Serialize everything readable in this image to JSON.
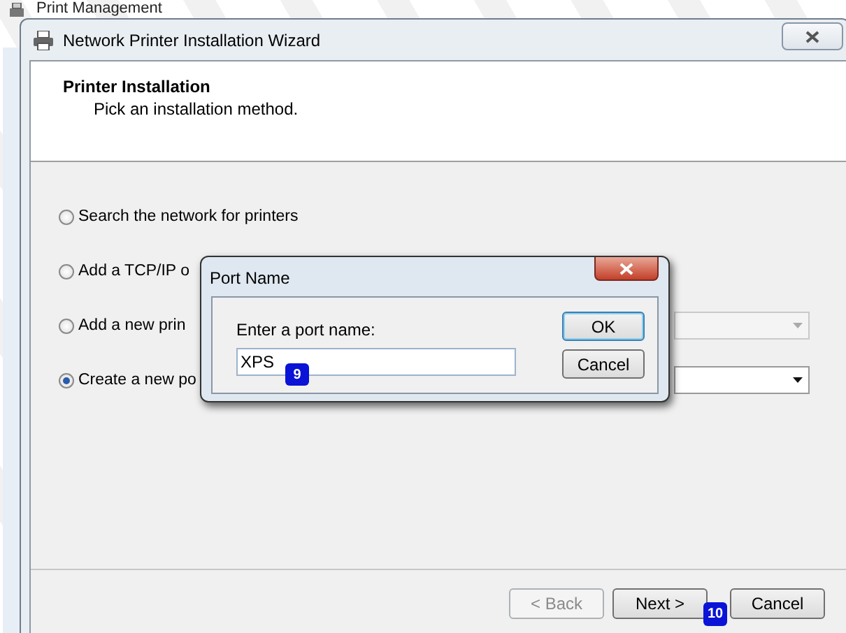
{
  "background_window": {
    "title": "Print Management"
  },
  "wizard": {
    "title": "Network Printer Installation Wizard",
    "header": {
      "title": "Printer Installation",
      "subtitle": "Pick an installation method."
    },
    "options": [
      {
        "label": "Search the network for printers",
        "selected": false
      },
      {
        "label": "Add a TCP/IP o",
        "selected": false
      },
      {
        "label": "Add a new prin",
        "selected": false,
        "dropdown": {
          "disabled": true
        }
      },
      {
        "label": "Create a new po",
        "selected": true,
        "dropdown": {
          "disabled": false
        }
      }
    ],
    "buttons": [
      {
        "label": "< Back",
        "disabled": true
      },
      {
        "label": "Next >",
        "disabled": false
      },
      {
        "label": "Cancel",
        "disabled": false
      }
    ],
    "step_badge": "10"
  },
  "port_dialog": {
    "title": "Port Name",
    "prompt": "Enter a port name:",
    "value": "XPS",
    "step_badge": "9",
    "buttons": [
      {
        "label": "OK",
        "focused": true
      },
      {
        "label": "Cancel",
        "focused": false
      }
    ]
  }
}
